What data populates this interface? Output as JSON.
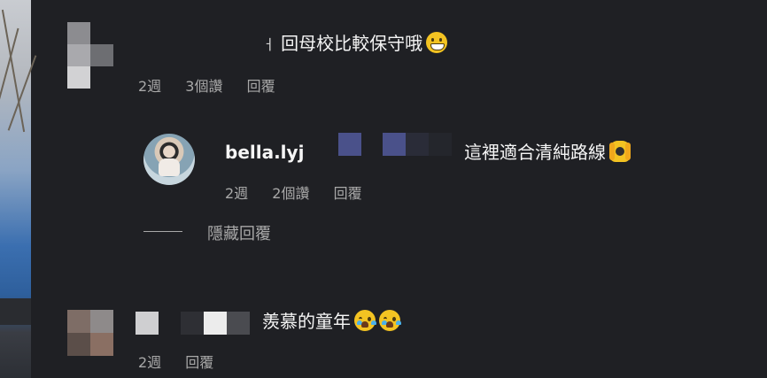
{
  "comments": [
    {
      "text": "回母校比較保守哦",
      "prefix_glyph": "ㅓ",
      "emoji": "grinning-face",
      "meta": {
        "time": "2週",
        "likes": "3個讚",
        "reply": "回覆"
      },
      "replies": [
        {
          "username": "bella.lyj",
          "text": "這裡適合清純路線",
          "emoji": "raising-hands",
          "meta": {
            "time": "2週",
            "likes": "2個讚",
            "reply": "回覆"
          }
        }
      ],
      "hide_replies_label": "隱藏回覆"
    },
    {
      "text": "羨慕的童年",
      "emoji": "crying-face",
      "meta": {
        "time": "2週",
        "reply": "回覆"
      }
    }
  ],
  "colors": {
    "background": "#1f2024",
    "text": "#f5f5f5",
    "meta_text": "#a8a8a8"
  }
}
